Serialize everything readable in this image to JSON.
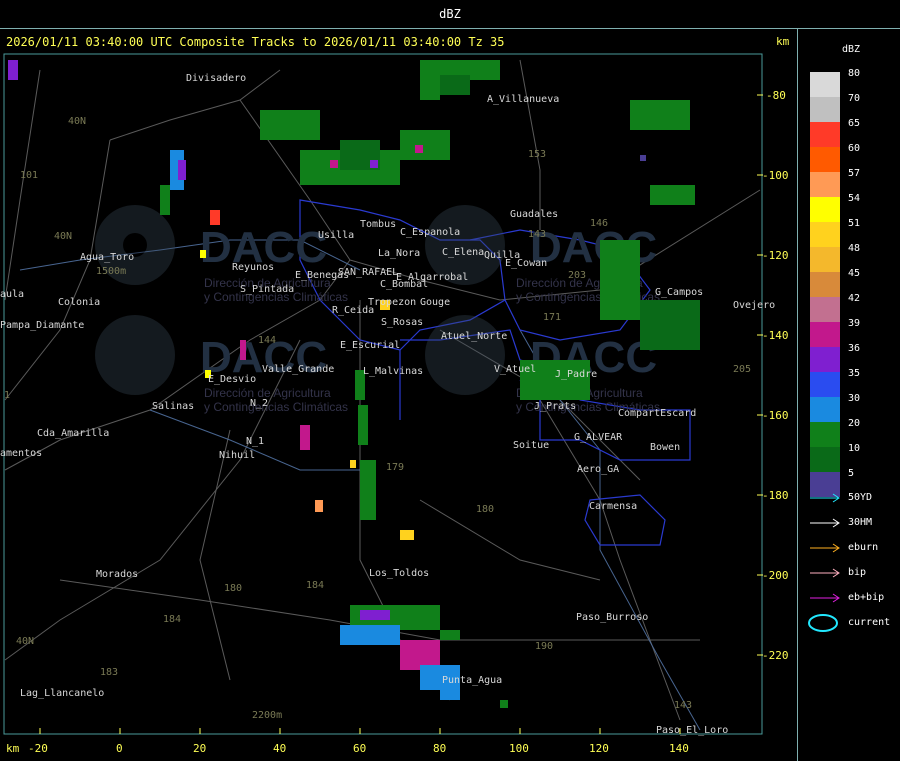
{
  "header": {
    "title": "dBZ"
  },
  "map": {
    "title": "2026/01/11 03:40:00 UTC Composite Tracks to 2026/01/11 03:40:00 Tz 35",
    "y_unit": "km",
    "x_unit": "km",
    "y_ticks": [
      "-80",
      "-100",
      "-120",
      "-140",
      "-160",
      "-180",
      "-200",
      "-220"
    ],
    "x_ticks": [
      "-20",
      "0",
      "20",
      "40",
      "60",
      "80",
      "100",
      "120",
      "140"
    ],
    "places": [
      "Divisadero",
      "A_Villanueva",
      "Agua_Toro",
      "Pampa_Diamante",
      "Reyunos",
      "S_Pintada",
      "E_Benegas",
      "SAN_RAFAEL",
      "E_Algarrobal",
      "Tombus",
      "Usilla",
      "C_Espanola",
      "C_Elena",
      "Quilla",
      "E_Cowan",
      "Guadales",
      "La_Nora",
      "C_Bombal",
      "Tropezon",
      "Gouge",
      "R_Ceida",
      "S_Rosas",
      "Atuel_Norte",
      "G_Campos",
      "Ovejero",
      "E_Escurial",
      "Valle_Grande",
      "L_Malvinas",
      "E_Desvio",
      "Salinas",
      "N_2",
      "V_Atuel",
      "J_Padre",
      "J_Prats",
      "CompartEscard",
      "G_ALVEAR",
      "Soitue",
      "Bowen",
      "Aero_GA",
      "N_1",
      "Nihuil",
      "Cda_Amarilla",
      "Carmensa",
      "Los_Toldos",
      "Morados",
      "Paso_Burroso",
      "Lag_Llancanelo",
      "Punta_Agua",
      "Paso_El_Loro",
      "Colonia",
      "aula",
      "amentos",
      "2200m",
      "1500m"
    ],
    "roads": [
      "40N",
      "101",
      "40N",
      "153",
      "143",
      "146",
      "171",
      "180",
      "184",
      "179",
      "180",
      "184",
      "183",
      "190",
      "205",
      "143",
      "144",
      "1",
      "40N",
      "203"
    ],
    "watermarks": [
      "DACC",
      "DACC",
      "DACC",
      "DACC",
      "Dirección de Agricultura y Contingencias Climáticas"
    ]
  },
  "legend": {
    "title": "dBZ",
    "levels": [
      {
        "value": "80",
        "color": "#d9d9d9"
      },
      {
        "value": "70",
        "color": "#c0c0c0"
      },
      {
        "value": "65",
        "color": "#ff3a28"
      },
      {
        "value": "60",
        "color": "#ff5a00"
      },
      {
        "value": "57",
        "color": "#ff9a55"
      },
      {
        "value": "54",
        "color": "#ffff00"
      },
      {
        "value": "51",
        "color": "#ffd21e"
      },
      {
        "value": "48",
        "color": "#f4b82c"
      },
      {
        "value": "45",
        "color": "#d88a3a"
      },
      {
        "value": "42",
        "color": "#c27090"
      },
      {
        "value": "39",
        "color": "#c2188c"
      },
      {
        "value": "36",
        "color": "#7f1fd0"
      },
      {
        "value": "35",
        "color": "#2a4cf0"
      },
      {
        "value": "30",
        "color": "#1a8ae0"
      },
      {
        "value": "20",
        "color": "#10801a"
      },
      {
        "value": "10",
        "color": "#0a6a18"
      },
      {
        "value": "5",
        "color": "#4a3e94"
      }
    ],
    "tracks": [
      {
        "label": "50YD",
        "color": "#22e8ff"
      },
      {
        "label": "30HM",
        "color": "#ffffff"
      },
      {
        "label": "eburn",
        "color": "#ffb020"
      },
      {
        "label": "bip",
        "color": "#ffb0c0"
      },
      {
        "label": "eb+bip",
        "color": "#e020e0"
      },
      {
        "label": "current",
        "color": "#22e8ff"
      }
    ]
  }
}
